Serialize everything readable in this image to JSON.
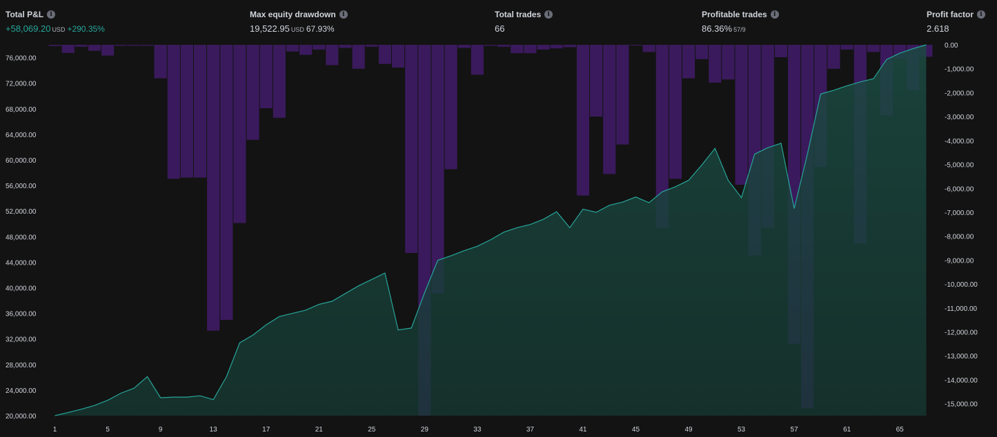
{
  "stats": {
    "total_pl": {
      "label": "Total P&L",
      "value": "+58,069.20",
      "unit": "USD",
      "percent": "+290.35%"
    },
    "max_drawdown": {
      "label": "Max equity drawdown",
      "value": "19,522.95",
      "unit": "USD",
      "percent": "67.93%"
    },
    "total_trades": {
      "label": "Total trades",
      "value": "66"
    },
    "profitable_trades": {
      "label": "Profitable trades",
      "value": "86.36%",
      "ratio": "57/9"
    },
    "profit_factor": {
      "label": "Profit factor",
      "value": "2.618"
    }
  },
  "colors": {
    "background": "#131313",
    "equity_line": "#26a69a",
    "equity_fill": "#163a33",
    "drawdown_bar": "#3a1a5c",
    "positive": "#26a69a"
  },
  "chart_data": {
    "type": "area",
    "x_ticks": [
      "1",
      "5",
      "9",
      "13",
      "17",
      "21",
      "25",
      "29",
      "33",
      "37",
      "41",
      "45",
      "49",
      "53",
      "57",
      "61",
      "65"
    ],
    "left_axis": {
      "ticks": [
        "20,000.00",
        "24,000.00",
        "28,000.00",
        "32,000.00",
        "36,000.00",
        "40,000.00",
        "44,000.00",
        "48,000.00",
        "52,000.00",
        "56,000.00",
        "60,000.00",
        "64,000.00",
        "68,000.00",
        "72,000.00",
        "76,000.00"
      ],
      "ylim": [
        20000,
        78000
      ]
    },
    "right_axis": {
      "ticks": [
        "0.00",
        "-1,000.00",
        "-2,000.00",
        "-3,000.00",
        "-4,000.00",
        "-5,000.00",
        "-6,000.00",
        "-7,000.00",
        "-8,000.00",
        "-9,000.00",
        "-10,000.00",
        "-11,000.00",
        "-12,000.00",
        "-13,000.00",
        "-14,000.00",
        "-15,000.00"
      ],
      "ylim": [
        -15500,
        0
      ]
    },
    "x": [
      1,
      2,
      3,
      4,
      5,
      6,
      7,
      8,
      9,
      10,
      11,
      12,
      13,
      14,
      15,
      16,
      17,
      18,
      19,
      20,
      21,
      22,
      23,
      24,
      25,
      26,
      27,
      28,
      29,
      30,
      31,
      32,
      33,
      34,
      35,
      36,
      37,
      38,
      39,
      40,
      41,
      42,
      43,
      44,
      45,
      46,
      47,
      48,
      49,
      50,
      51,
      52,
      53,
      54,
      55,
      56,
      57,
      58,
      59,
      60,
      61,
      62,
      63,
      64,
      65,
      66,
      67
    ],
    "series": [
      {
        "type": "area",
        "axis": "left",
        "values": [
          20000,
          20500,
          21000,
          21600,
          22400,
          23500,
          24300,
          26100,
          22800,
          22900,
          22900,
          23100,
          22500,
          26100,
          31400,
          32600,
          34200,
          35500,
          36000,
          36500,
          37400,
          37900,
          39100,
          40300,
          41300,
          42300,
          33400,
          33700,
          39200,
          44300,
          45000,
          45800,
          46500,
          47500,
          48700,
          49400,
          49900,
          50700,
          51900,
          49400,
          52300,
          51800,
          52900,
          53400,
          54200,
          53300,
          55000,
          55800,
          56800,
          59200,
          61800,
          56800,
          54100,
          60900,
          61900,
          62600,
          52400,
          60900,
          70300,
          70900,
          71600,
          72200,
          72700,
          75700,
          76700,
          77400,
          78000
        ]
      },
      {
        "type": "bar",
        "axis": "right",
        "values": [
          -50,
          -340,
          -80,
          -250,
          -450,
          -40,
          -40,
          -40,
          -1400,
          -5600,
          -5550,
          -5550,
          -11950,
          -11500,
          -7450,
          -3970,
          -2650,
          -3050,
          -280,
          -420,
          -200,
          -850,
          -130,
          -1000,
          -80,
          -800,
          -950,
          -8700,
          -15500,
          -10400,
          -5200,
          -130,
          -1250,
          -40,
          -80,
          -350,
          -350,
          -200,
          -150,
          -100,
          -6300,
          -3000,
          -5400,
          -4170,
          -30,
          -300,
          -7650,
          -5600,
          -1400,
          -600,
          -1580,
          -1450,
          -5850,
          -8800,
          -7650,
          -520,
          -12500,
          -15200,
          -5100,
          -1000,
          -200,
          -8300,
          -300,
          -2950,
          -600,
          -1900,
          -500
        ]
      }
    ]
  }
}
